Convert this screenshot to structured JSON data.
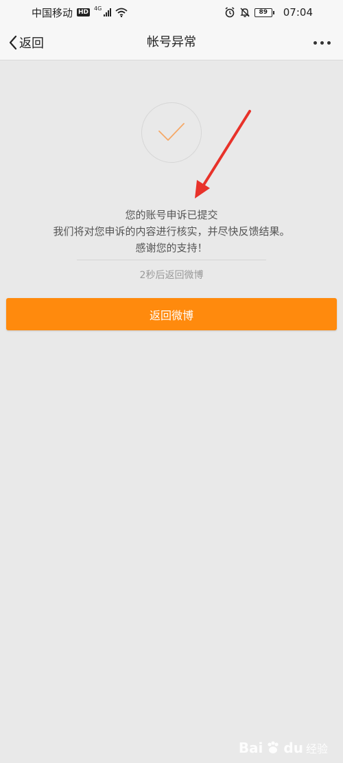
{
  "status_bar": {
    "carrier": "中国移动",
    "hd_badge": "HD",
    "network": "4G",
    "battery": "89",
    "time": "07:04"
  },
  "nav": {
    "back_label": "返回",
    "title": "帐号异常",
    "more_icon": "more-horizontal-icon"
  },
  "result": {
    "icon": "checkmark-icon",
    "accent_color": "#f5a867",
    "line1": "您的账号申诉已提交",
    "line2": "我们将对您申诉的内容进行核实，并尽快反馈结果。",
    "line3": "感谢您的支持！",
    "countdown": "2秒后返回微博"
  },
  "action": {
    "button_label": "返回微博",
    "button_color": "#ff8a0d"
  },
  "annotation": {
    "arrow_color": "#e8322a"
  },
  "watermark": {
    "brand": "Bai",
    "brand_suffix": "du",
    "sub": "经验"
  }
}
